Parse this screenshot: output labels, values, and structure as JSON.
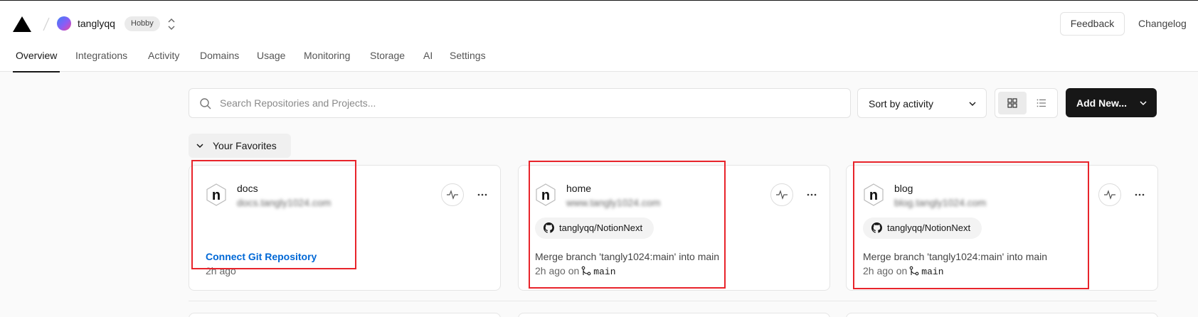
{
  "header": {
    "team_name": "tanglyqq",
    "plan_badge": "Hobby",
    "feedback_label": "Feedback",
    "changelog_label": "Changelog"
  },
  "nav": {
    "items": [
      {
        "label": "Overview",
        "active": true
      },
      {
        "label": "Integrations"
      },
      {
        "label": "Activity"
      },
      {
        "label": "Domains"
      },
      {
        "label": "Usage"
      },
      {
        "label": "Monitoring"
      },
      {
        "label": "Storage"
      },
      {
        "label": "AI"
      },
      {
        "label": "Settings"
      }
    ]
  },
  "toolbar": {
    "search_placeholder": "Search Repositories and Projects...",
    "sort_label": "Sort by activity",
    "add_new_label": "Add New..."
  },
  "favorites": {
    "label": "Your Favorites"
  },
  "projects": [
    {
      "name": "docs",
      "domain": "docs.tangly1024.com",
      "connect_label": "Connect Git Repository",
      "time": "2h ago"
    },
    {
      "name": "home",
      "domain": "www.tangly1024.com",
      "repo": "tanglyqq/NotionNext",
      "commit": "Merge branch 'tangly1024:main' into main",
      "time": "2h ago on",
      "branch": "main"
    },
    {
      "name": "blog",
      "domain": "blog.tangly1024.com",
      "repo": "tanglyqq/NotionNext",
      "commit": "Merge branch 'tangly1024:main' into main",
      "time": "2h ago on",
      "branch": "main"
    }
  ],
  "colors": {
    "accent_link": "#0068d6",
    "primary_button": "#171717",
    "highlight": "#e8242b"
  }
}
